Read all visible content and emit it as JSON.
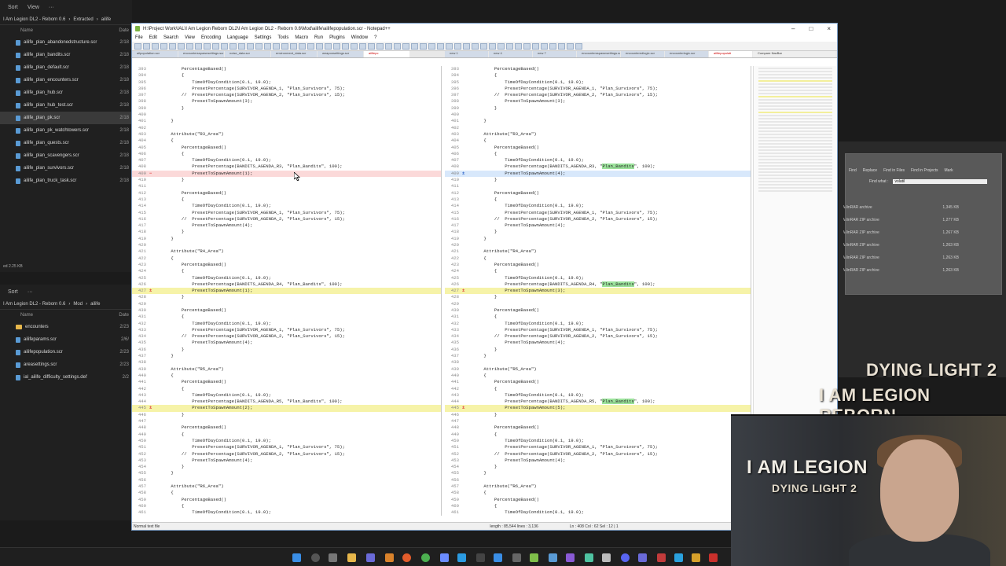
{
  "explorer_top": {
    "toolbar": [
      "Sort",
      "View",
      "···"
    ],
    "address": [
      "I Am Legion DL2 - Reborn 0.6",
      "›",
      "Extracted",
      "›",
      "ailife"
    ],
    "col_name": "Name",
    "col_date": "Date",
    "files": [
      {
        "name": "ailife_plan_abandonedstructure.scr",
        "date": "2/18"
      },
      {
        "name": "ailife_plan_bandits.scr",
        "date": "2/18"
      },
      {
        "name": "ailife_plan_default.scr",
        "date": "2/18"
      },
      {
        "name": "ailife_plan_encounters.scr",
        "date": "2/18"
      },
      {
        "name": "ailife_plan_hub.scr",
        "date": "2/18"
      },
      {
        "name": "ailife_plan_hub_test.scr",
        "date": "2/18"
      },
      {
        "name": "ailife_plan_pk.scr",
        "date": "2/18"
      },
      {
        "name": "ailife_plan_pk_watchtowers.scr",
        "date": "2/18"
      },
      {
        "name": "ailife_plan_quests.scr",
        "date": "2/18"
      },
      {
        "name": "ailife_plan_scavengers.scr",
        "date": "2/18"
      },
      {
        "name": "ailife_plan_survivors.scr",
        "date": "2/18"
      },
      {
        "name": "ailife_plan_truck_task.scr",
        "date": "2/18"
      }
    ],
    "status": "ed  2.25 KB"
  },
  "explorer_bottom": {
    "toolbar": [
      "Sort",
      "···"
    ],
    "address": [
      "I Am Legion DL2 - Reborn 0.6",
      "›",
      "Mod",
      "›",
      "ailife"
    ],
    "col_name": "Name",
    "col_date": "Date",
    "files": [
      {
        "name": "encounters",
        "date": "2/23",
        "folder": true
      },
      {
        "name": "ailifeparams.scr",
        "date": "2/6/"
      },
      {
        "name": "ailifepopulation.scr",
        "date": "2/23"
      },
      {
        "name": "areasettings.scr",
        "date": "2/23"
      },
      {
        "name": "ial_ailife_difficulty_settings.def",
        "date": "2/2"
      }
    ]
  },
  "npp": {
    "title": "H:\\Project Work\\IAL\\I Am Legion Reborn DL2\\I Am Legion DL2 - Reborn 0.6\\Mod\\ailife\\ailifepopulation.scr - Notepad++",
    "menu": [
      "File",
      "Edit",
      "Search",
      "View",
      "Encoding",
      "Language",
      "Settings",
      "Tools",
      "Macro",
      "Run",
      "Plugins",
      "Window",
      "?"
    ],
    "tabs_left": [
      "ailpopulation.scr",
      "encountersspawnsettings.scr",
      "noise_data.scr",
      "environment_data.scr",
      "weaponsettings.scr",
      "ailifepc"
    ],
    "tabs_right": [
      "new 1",
      "new 4",
      "new 7",
      "encountersspawnsettings.scr",
      "encounteredlogic.scr",
      "encounterlogic.scr",
      "ailifepopulati"
    ],
    "compare_nav": "Compare NavBar",
    "status_left": "Normal text file",
    "status_length": "length : 85,544    lines : 3,136",
    "status_pos": "Ln : 408    Col : 62    Sel : 12 | 1"
  },
  "code_left": [
    {
      "n": "393",
      "t": "        PercentageBased()"
    },
    {
      "n": "394",
      "t": "        {"
    },
    {
      "n": "395",
      "t": "            TimeOfDayCondition(0.1, 19.0);"
    },
    {
      "n": "396",
      "t": "            PresetPercentage(SURVIVOR_AGENDA_1, \"Plan_Survivors\", 75);"
    },
    {
      "n": "397",
      "t": "        //  PresetPercentage(SURVIVOR_AGENDA_2, \"Plan_Survivors\", 15);"
    },
    {
      "n": "398",
      "t": "            PresetToSpawnAmount(3);"
    },
    {
      "n": "399",
      "t": "        }"
    },
    {
      "n": "400",
      "t": ""
    },
    {
      "n": "401",
      "t": "    }"
    },
    {
      "n": "402",
      "t": ""
    },
    {
      "n": "403",
      "t": "    Attribute(\"R3_Area\")"
    },
    {
      "n": "404",
      "t": "    {"
    },
    {
      "n": "405",
      "t": "        PercentageBased()"
    },
    {
      "n": "406",
      "t": "        {"
    },
    {
      "n": "407",
      "t": "            TimeOfDayCondition(0.1, 19.0);"
    },
    {
      "n": "408",
      "t": "            PresetPercentage(BANDITS_AGENDA_R3, \"Plan_Bandits\", 100);"
    },
    {
      "n": "409",
      "t": "            PresetToSpawnAmount(1);",
      "hl": "red"
    },
    {
      "n": "410",
      "t": "        }"
    },
    {
      "n": "411",
      "t": ""
    },
    {
      "n": "412",
      "t": "        PercentageBased()"
    },
    {
      "n": "413",
      "t": "        {"
    },
    {
      "n": "414",
      "t": "            TimeOfDayCondition(0.1, 19.0);"
    },
    {
      "n": "415",
      "t": "            PresetPercentage(SURVIVOR_AGENDA_1, \"Plan_Survivors\", 75);"
    },
    {
      "n": "416",
      "t": "        //  PresetPercentage(SURVIVOR_AGENDA_2, \"Plan_Survivors\", 15);"
    },
    {
      "n": "417",
      "t": "            PresetToSpawnAmount(4);"
    },
    {
      "n": "418",
      "t": "        }"
    },
    {
      "n": "419",
      "t": "    }"
    },
    {
      "n": "420",
      "t": ""
    },
    {
      "n": "421",
      "t": "    Attribute(\"R4_Area\")"
    },
    {
      "n": "422",
      "t": "    {"
    },
    {
      "n": "423",
      "t": "        PercentageBased()"
    },
    {
      "n": "424",
      "t": "        {"
    },
    {
      "n": "425",
      "t": "            TimeOfDayCondition(0.1, 19.0);"
    },
    {
      "n": "426",
      "t": "            PresetPercentage(BANDITS_AGENDA_R4, \"Plan_Bandits\", 100);"
    },
    {
      "n": "427",
      "t": "            PresetToSpawnAmount(1);",
      "hl": "yel"
    },
    {
      "n": "428",
      "t": "        }"
    },
    {
      "n": "429",
      "t": ""
    },
    {
      "n": "430",
      "t": "        PercentageBased()"
    },
    {
      "n": "431",
      "t": "        {"
    },
    {
      "n": "432",
      "t": "            TimeOfDayCondition(0.1, 19.0);"
    },
    {
      "n": "433",
      "t": "            PresetPercentage(SURVIVOR_AGENDA_1, \"Plan_Survivors\", 75);"
    },
    {
      "n": "434",
      "t": "        //  PresetPercentage(SURVIVOR_AGENDA_2, \"Plan_Survivors\", 15);"
    },
    {
      "n": "435",
      "t": "            PresetToSpawnAmount(4);"
    },
    {
      "n": "436",
      "t": "        }"
    },
    {
      "n": "437",
      "t": "    }"
    },
    {
      "n": "438",
      "t": ""
    },
    {
      "n": "439",
      "t": "    Attribute(\"R5_Area\")"
    },
    {
      "n": "440",
      "t": "    {"
    },
    {
      "n": "441",
      "t": "        PercentageBased()"
    },
    {
      "n": "442",
      "t": "        {"
    },
    {
      "n": "443",
      "t": "            TimeOfDayCondition(0.1, 19.0);"
    },
    {
      "n": "444",
      "t": "            PresetPercentage(BANDITS_AGENDA_R5, \"Plan_Bandits\", 100);"
    },
    {
      "n": "445",
      "t": "            PresetToSpawnAmount(2);",
      "hl": "yel"
    },
    {
      "n": "446",
      "t": "        }"
    },
    {
      "n": "447",
      "t": ""
    },
    {
      "n": "448",
      "t": "        PercentageBased()"
    },
    {
      "n": "449",
      "t": "        {"
    },
    {
      "n": "450",
      "t": "            TimeOfDayCondition(0.1, 19.0);"
    },
    {
      "n": "451",
      "t": "            PresetPercentage(SURVIVOR_AGENDA_1, \"Plan_Survivors\", 75);"
    },
    {
      "n": "452",
      "t": "        //  PresetPercentage(SURVIVOR_AGENDA_2, \"Plan_Survivors\", 15);"
    },
    {
      "n": "453",
      "t": "            PresetToSpawnAmount(4);"
    },
    {
      "n": "454",
      "t": "        }"
    },
    {
      "n": "455",
      "t": "    }"
    },
    {
      "n": "456",
      "t": ""
    },
    {
      "n": "457",
      "t": "    Attribute(\"R6_Area\")"
    },
    {
      "n": "458",
      "t": "    {"
    },
    {
      "n": "459",
      "t": "        PercentageBased()"
    },
    {
      "n": "460",
      "t": "        {"
    },
    {
      "n": "461",
      "t": "            TimeOfDayCondition(0.1, 19.0);"
    }
  ],
  "code_right_diffs": {
    "409": {
      "t": "            PresetToSpawnAmount(4);",
      "hl": "blue"
    },
    "427": {
      "t": "            PresetToSpawnAmount(3);",
      "hl": "yel"
    },
    "445": {
      "t": "            PresetToSpawnAmount(5);",
      "hl": "yel"
    }
  },
  "right_panel": {
    "rows": [
      {
        "type": "WinRAR archive",
        "size": "1,345 KB"
      },
      {
        "type": "WinRAR ZIP archive",
        "size": "1,277 KB"
      },
      {
        "type": "WinRAR ZIP archive",
        "size": "1,267 KB"
      },
      {
        "type": "WinRAR ZIP archive",
        "size": "1,263 KB"
      },
      {
        "type": "WinRAR ZIP archive",
        "size": "1,263 KB"
      },
      {
        "type": "WinRAR ZIP archive",
        "size": "1,263 KB"
      }
    ],
    "find_tabs": [
      "Find",
      "Replace",
      "Find in Files",
      "Find in Projects",
      "Mark"
    ],
    "find_what_label": "Find what :",
    "find_what_value": "volatil"
  },
  "logos": {
    "dl2_title": "DYING LIGHT 2",
    "reborn_title": "I AM LEGION REBORN",
    "cam_title": "I AM LEGION",
    "cam_subtitle": "DYING LIGHT 2"
  },
  "colors": {
    "taskbar": "#1f1f1f",
    "diff_red": "#fbd9d9",
    "diff_yellow": "#f6f3a8",
    "diff_blue": "#d8e8fb"
  }
}
